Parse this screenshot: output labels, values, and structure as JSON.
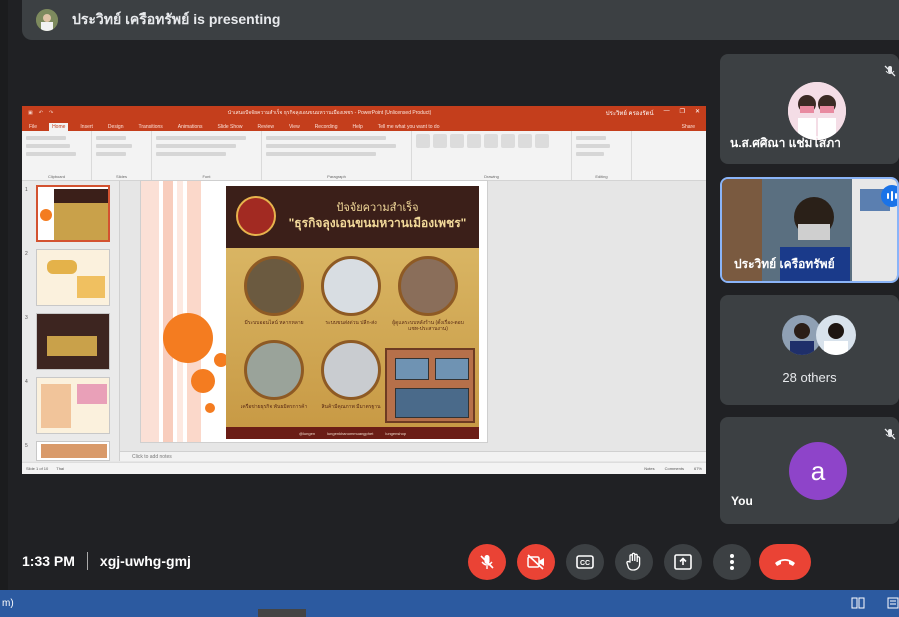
{
  "presenting_bar": {
    "text": "ประวิทย์ เครือทรัพย์ is presenting"
  },
  "powerpoint": {
    "title_center": "นำเสนอปัจจัยความสำเร็จ ธุรกิจลุงเอนขนมหวานเมืองเพชร - PowerPoint (Unlicensed Product)",
    "account": "ประวิทย์ ครองรัตน์",
    "share_label": "Share",
    "tabs": [
      "File",
      "Home",
      "Insert",
      "Design",
      "Transitions",
      "Animations",
      "Slide Show",
      "Review",
      "View",
      "Recording",
      "Help",
      "Tell me what you want to do"
    ],
    "ribbon_groups": [
      "Clipboard",
      "Slides",
      "Font",
      "Paragraph",
      "Drawing",
      "Editing"
    ],
    "thumb_numbers": [
      "1",
      "2",
      "3",
      "4",
      "5"
    ],
    "notes_placeholder": "Click to add notes",
    "status_left": "Slide 1 of 10",
    "status_lang": "Thai",
    "status_notes": "Notes",
    "status_comments": "Comments",
    "zoom": "67%"
  },
  "slide": {
    "title_line1": "ปัจจัยความสำเร็จ",
    "title_line2": "\"ธุรกิจลุงเอนขนมหวานเมืองเพชร\"",
    "items": [
      "มีระบบออนไลน์ หลากหลาย",
      "ระบบขนส่งด่วน ปลีก-ส่ง",
      "ผู้ดูแลระบบหลังร้าน (ตั้งเรื่อง-ตอบแชท-ประสานงาน)",
      "เครือข่ายธุรกิจ พันธมิตรการค้า",
      "สินค้ามีคุณภาพ มีมาตรฐาน"
    ],
    "footer": [
      "@lungen",
      "lungenkhanommuangphet",
      "lungenshop"
    ]
  },
  "tiles": {
    "participant1": "น.ส.ศศิณา แช่มโสภา",
    "participant2": "ประวิทย์ เครือทรัพย์",
    "others": "28 others",
    "you_initial": "a",
    "you_label": "You"
  },
  "meeting": {
    "time": "1:33 PM",
    "code": "xgj-uwhg-gmj"
  },
  "controls": [
    "mic-off",
    "camera-off",
    "captions",
    "raise-hand",
    "present",
    "more",
    "end-call"
  ],
  "taskbar": {
    "left_text": "m)"
  },
  "colors": {
    "end_call": "#ea4335",
    "speaking": "#1a73e8",
    "ppt_accent": "#c43e1c",
    "taskbar": "#2c5aa0"
  }
}
